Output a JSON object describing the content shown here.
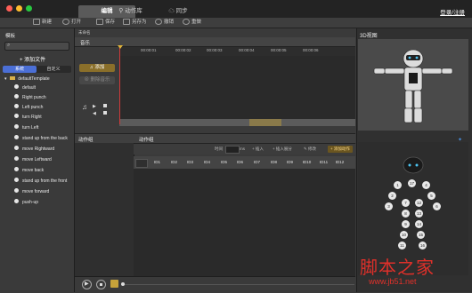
{
  "titlebar": {
    "tabs": [
      "编辑",
      "动作库",
      "同步"
    ],
    "login": "登录/注册"
  },
  "toolbar": {
    "new": "新建",
    "open": "打开",
    "save": "保存",
    "saveas": "另存为",
    "undo": "撤销",
    "redo": "重做"
  },
  "left": {
    "header": "模板",
    "add_file": "+ 添加文件",
    "tabs": [
      "系统",
      "自定义"
    ],
    "folder": "defaultTemplate",
    "items": [
      "default",
      "Right punch",
      "Left punch",
      "turn Right",
      "turn Left",
      "stand up from the back",
      "move Rightward",
      "move Leftward",
      "move back",
      "stand up from the front",
      "move forward",
      "push-up"
    ]
  },
  "center": {
    "filename": "未命名",
    "music_label": "音乐",
    "add_button": "添加",
    "delete_music_button": "删除音乐",
    "ticks": [
      "00:00:01",
      "00:00:02",
      "00:00:03",
      "00:00:04",
      "00:00:05",
      "00:00:06"
    ],
    "action_group_left": "动作组",
    "action_group_right": "动作组",
    "time_label": "时间",
    "ms_label": "ms",
    "insert": "插入",
    "insert_split": "插入展分",
    "modify": "修改",
    "add_action": "+ 添加动作",
    "frames": [
      "ID1",
      "ID2",
      "ID3",
      "ID4",
      "ID5",
      "ID6",
      "ID7",
      "ID8",
      "ID9",
      "ID10",
      "ID11",
      "ID12"
    ]
  },
  "right": {
    "header": "3D视图",
    "joints": [
      "1",
      "2",
      "3",
      "4",
      "5",
      "6",
      "7",
      "8",
      "9",
      "10",
      "11",
      "12",
      "13",
      "14",
      "15",
      "16"
    ]
  },
  "watermark": {
    "text": "脚本之家",
    "url": "www.jb51.net"
  }
}
